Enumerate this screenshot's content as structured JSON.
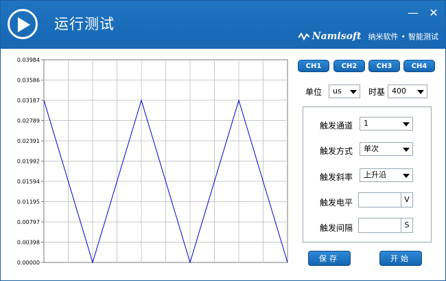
{
  "app": {
    "title": "运行测试",
    "minimize": "—",
    "close": "✕"
  },
  "brand": {
    "logo": "Namisoft",
    "cn_name": "纳米软件",
    "sep": "•",
    "tagline": "智能测试"
  },
  "channels": [
    "CH1",
    "CH2",
    "CH3",
    "CH4"
  ],
  "controls": {
    "unit_label": "单位",
    "unit_value": "us",
    "timebase_label": "时基",
    "timebase_value": "400"
  },
  "trigger": {
    "channel_label": "触发通道",
    "channel_value": "1",
    "mode_label": "触发方式",
    "mode_value": "单次",
    "slope_label": "触发斜率",
    "slope_value": "上升沿",
    "level_label": "触发电平",
    "level_value": "",
    "level_unit": "V",
    "interval_label": "触发间隔",
    "interval_value": "",
    "interval_unit": "S"
  },
  "actions": {
    "save": "保存",
    "start": "开始"
  },
  "chart_data": {
    "type": "line",
    "ylim": [
      0.0,
      0.03984
    ],
    "y_ticks": [
      "0.03984",
      "0.03586",
      "0.03187",
      "0.02789",
      "0.02391",
      "0.01992",
      "0.01594",
      "0.01195",
      "0.00797",
      "0.00398",
      "0.00000"
    ],
    "x_divisions": 10,
    "grid": true,
    "line_color": "#0000cc",
    "series": [
      {
        "x": [
          0,
          2,
          4,
          6,
          8,
          10
        ],
        "values": [
          0.03187,
          0.0,
          0.03187,
          0.0,
          0.03187,
          0.0
        ]
      }
    ]
  }
}
